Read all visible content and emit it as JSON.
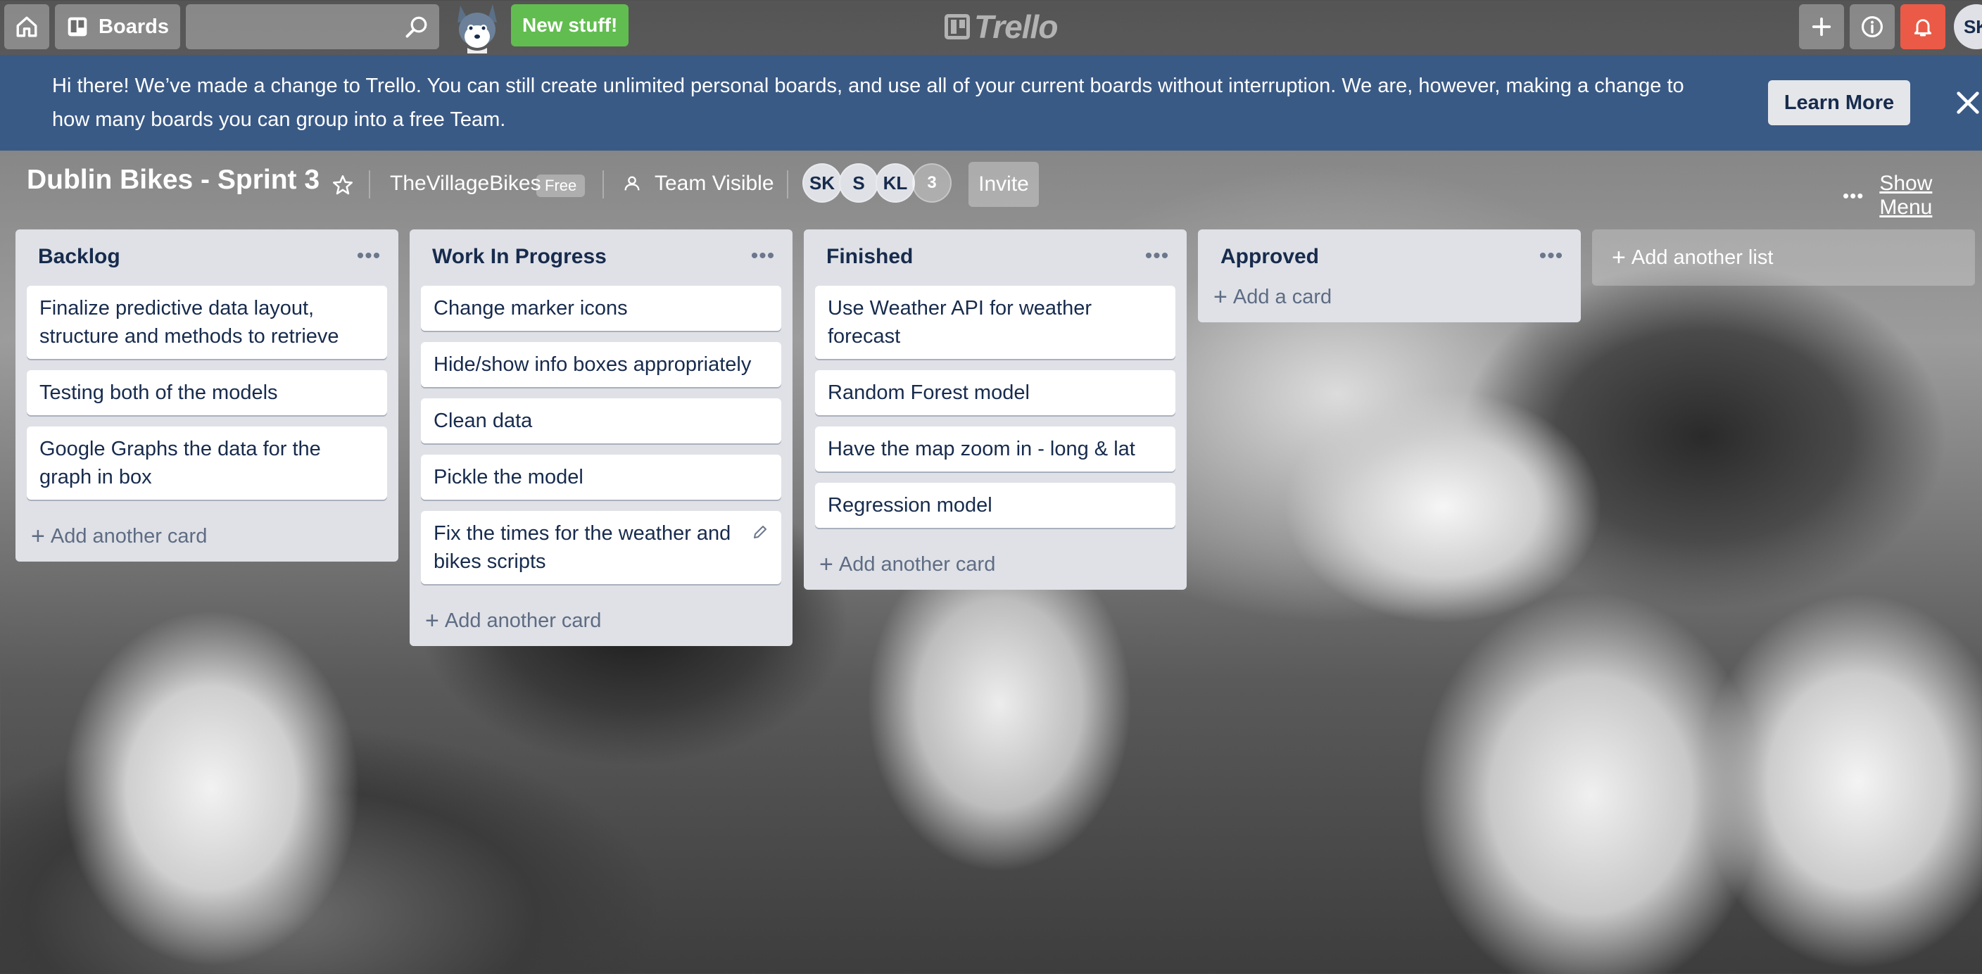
{
  "header": {
    "boards_label": "Boards",
    "new_stuff_label": "New stuff!",
    "logo_text": "Trello",
    "user_initials": "SK"
  },
  "banner": {
    "message": "Hi there! We’ve made a change to Trello. You can still create unlimited personal boards, and use all of your current boards without interruption. We are, however, making a change to how many boards you can group into a free Team.",
    "learn_more_label": "Learn More"
  },
  "board": {
    "title": "Dublin Bikes - Sprint 3",
    "team_name": "TheVillageBikes",
    "team_plan": "Free",
    "visibility": "Team Visible",
    "members": [
      "SK",
      "S",
      "KL"
    ],
    "extra_members": "3",
    "invite_label": "Invite",
    "show_menu_label": "Show Menu",
    "add_list_label": "Add another list"
  },
  "lists": [
    {
      "name": "Backlog",
      "cards": [
        "Finalize predictive data layout, structure and methods to retrieve",
        "Testing both of the models",
        "Google Graphs the data for the graph in box"
      ],
      "add_label": "Add another card"
    },
    {
      "name": "Work In Progress",
      "cards": [
        "Change marker icons",
        "Hide/show info boxes appropriately",
        "Clean data",
        "Pickle the model",
        "Fix the times for the weather and bikes scripts"
      ],
      "add_label": "Add another card"
    },
    {
      "name": "Finished",
      "cards": [
        "Use Weather API for weather forecast",
        "Random Forest model",
        "Have the map zoom in - long & lat",
        "Regression model"
      ],
      "add_label": "Add another card"
    },
    {
      "name": "Approved",
      "cards": [],
      "add_label": "Add a card"
    }
  ],
  "colors": {
    "new_stuff": "#61bd4f",
    "notification": "#eb5a46",
    "banner": "#3a5a86",
    "list_bg": "#dfe1e6"
  }
}
